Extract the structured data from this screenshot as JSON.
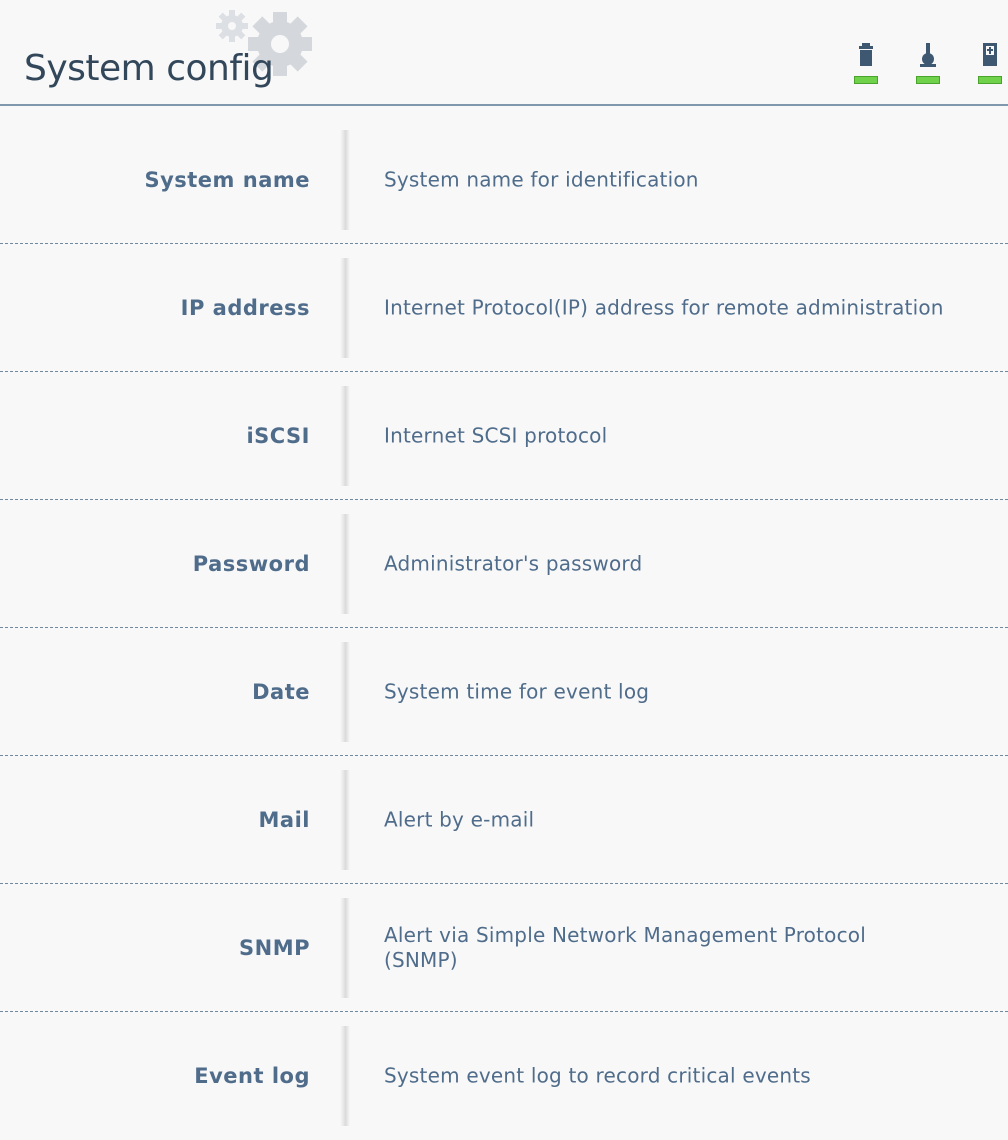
{
  "header": {
    "title": "System config",
    "toolbar": [
      {
        "icon": "trash-icon",
        "status": "green"
      },
      {
        "icon": "probe-icon",
        "status": "green"
      },
      {
        "icon": "save-icon",
        "status": "green"
      }
    ]
  },
  "colors": {
    "label": "#4f6c8b",
    "title": "#33475b",
    "divider": "#6e8aa3",
    "led": "#6fd24a"
  },
  "items": [
    {
      "label": "System name",
      "description": "System name for identification"
    },
    {
      "label": "IP address",
      "description": "Internet Protocol(IP) address for remote administration"
    },
    {
      "label": "iSCSI",
      "description": "Internet SCSI protocol"
    },
    {
      "label": "Password",
      "description": "Administrator's password"
    },
    {
      "label": "Date",
      "description": "System time for event log"
    },
    {
      "label": "Mail",
      "description": "Alert by e-mail"
    },
    {
      "label": "SNMP",
      "description": "Alert via Simple Network Management Protocol (SNMP)"
    },
    {
      "label": "Event log",
      "description": "System event log to record critical events"
    }
  ]
}
